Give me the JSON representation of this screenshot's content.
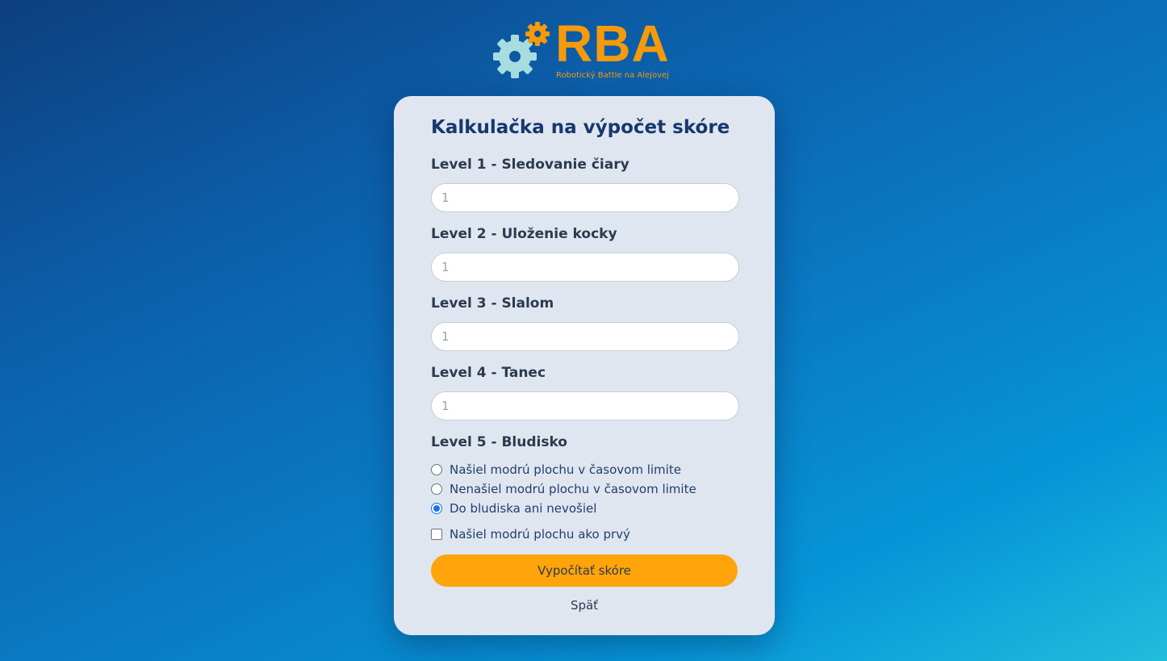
{
  "logo": {
    "title": "RBA",
    "subtitle": "Robotický Battle na Alejovej",
    "gear_icon": "gears-icon",
    "colors": {
      "orange": "#f59a0a",
      "teal": "#a8dde0"
    }
  },
  "form": {
    "title": "Kalkulačka na výpočet skóre",
    "levels": [
      {
        "label": "Level 1 - Sledovanie čiary",
        "placeholder": "1"
      },
      {
        "label": "Level 2 - Uloženie kocky",
        "placeholder": "1"
      },
      {
        "label": "Level 3 - Slalom",
        "placeholder": "1"
      },
      {
        "label": "Level 4 - Tanec",
        "placeholder": "1"
      }
    ],
    "level5": {
      "label": "Level 5 - Bludisko",
      "options": [
        {
          "label": "Našiel modrú plochu v časovom limite",
          "checked": false
        },
        {
          "label": "Nenašiel modrú plochu v časovom limite",
          "checked": false
        },
        {
          "label": "Do bludiska ani nevošiel",
          "checked": true
        }
      ],
      "first_checkbox": {
        "label": "Našiel modrú plochu ako prvý",
        "checked": false
      }
    },
    "submit_label": "Vypočítať skóre",
    "back_label": "Späť",
    "colors": {
      "button": "#ffa40a",
      "card": "#e0e6ef",
      "title": "#17376e"
    }
  }
}
